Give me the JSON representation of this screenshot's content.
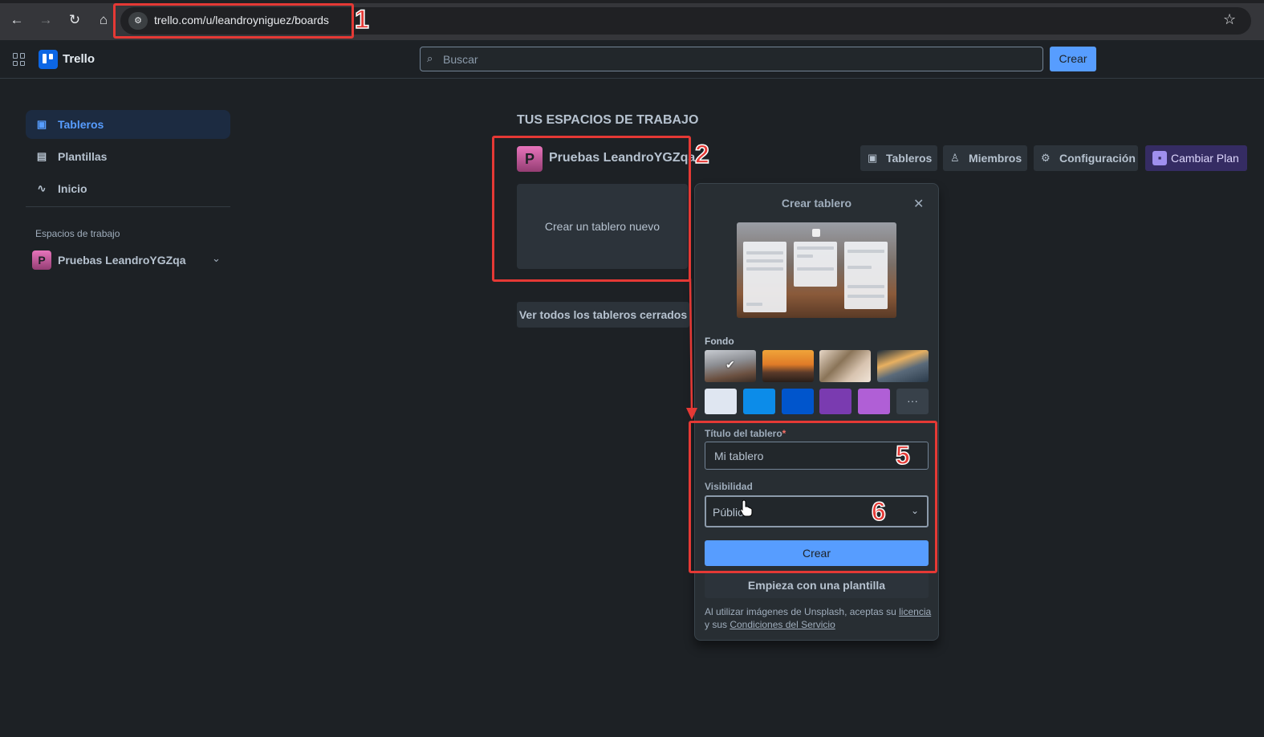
{
  "browser": {
    "url": "trello.com/u/leandroyniguez/boards"
  },
  "header": {
    "app_name": "Trello",
    "search_placeholder": "Buscar",
    "create_label": "Crear"
  },
  "sidebar": {
    "items": [
      {
        "label": "Tableros",
        "icon": "board-icon",
        "active": true
      },
      {
        "label": "Plantillas",
        "icon": "template-icon",
        "active": false
      },
      {
        "label": "Inicio",
        "icon": "activity-icon",
        "active": false
      }
    ],
    "workspaces_heading": "Espacios de trabajo",
    "workspace": {
      "initial": "P",
      "name": "Pruebas LeandroYGZqa"
    }
  },
  "main": {
    "heading": "TUS ESPACIOS DE TRABAJO",
    "workspace_initial": "P",
    "workspace_title": "Pruebas LeandroYGZqa",
    "buttons": {
      "boards": "Tableros",
      "members": "Miembros",
      "settings": "Configuración",
      "upgrade": "Cambiar Plan"
    },
    "new_board_tile": "Crear un tablero nuevo",
    "closed_boards": "Ver todos los tableros cerrados"
  },
  "create_board": {
    "title": "Crear tablero",
    "background_label": "Fondo",
    "more_label": "···",
    "background_colors": [
      "#dfe6f1",
      "#0c8ce9",
      "#0055cc",
      "#7a3bb0",
      "#b05fd6"
    ],
    "title_label": "Título del tablero",
    "required_mark": "*",
    "title_value": "Mi tablero",
    "visibility_label": "Visibilidad",
    "visibility_value": "Público",
    "create_label": "Crear",
    "template_label": "Empieza con una plantilla",
    "legal_prefix": "Al utilizar imágenes de Unsplash, aceptas su ",
    "legal_license": "licencia",
    "legal_middle": "y sus ",
    "legal_terms": "Condiciones del Servicio"
  },
  "annotations": {
    "n1": "1",
    "n2": "2",
    "n5": "5",
    "n6": "6",
    "color": "#e53935"
  }
}
